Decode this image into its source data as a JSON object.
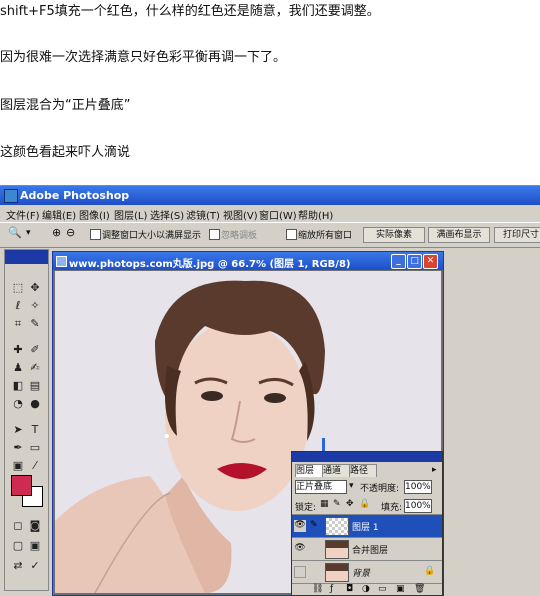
{
  "article": {
    "p1": "shift+F5填充一个红色，什么样的红色还是随意，我们还要调整。",
    "p2": "因为很难一次选择满意只好色彩平衡再调一下了。",
    "p3": "图层混合为“正片叠底”",
    "p4": "这颜色看起来吓人滴说"
  },
  "app": {
    "title": "Adobe Photoshop",
    "menu": [
      "文件(F)",
      "编辑(E)",
      "图像(I)",
      "图层(L)",
      "选择(S)",
      "滤镜(T)",
      "视图(V)",
      "窗口(W)",
      "帮助(H)"
    ],
    "options": {
      "resize_label": "调整窗口大小以满屏显示",
      "ignore_palettes": "忽略调板",
      "zoom_all": "缩放所有窗口",
      "actual_pixels": "实际像素",
      "fit_screen": "满画布显示",
      "print_size": "打印尺寸"
    }
  },
  "document": {
    "title": "www.photops.com丸版.jpg @ 66.7% (图层 1, RGB/8)",
    "foreground_color": "#cf2b52",
    "background_color": "#ffffff"
  },
  "layers_panel": {
    "tabs": [
      "图层",
      "通道",
      "路径"
    ],
    "blend_mode": "正片叠底",
    "opacity_label": "不透明度:",
    "opacity_value": "100%",
    "lock_label": "锁定:",
    "fill_label": "填充:",
    "fill_value": "100%",
    "layers": [
      {
        "name": "图层 1",
        "selected": true
      },
      {
        "name": "合并图层",
        "selected": false
      },
      {
        "name": "背景",
        "selected": false
      }
    ]
  }
}
